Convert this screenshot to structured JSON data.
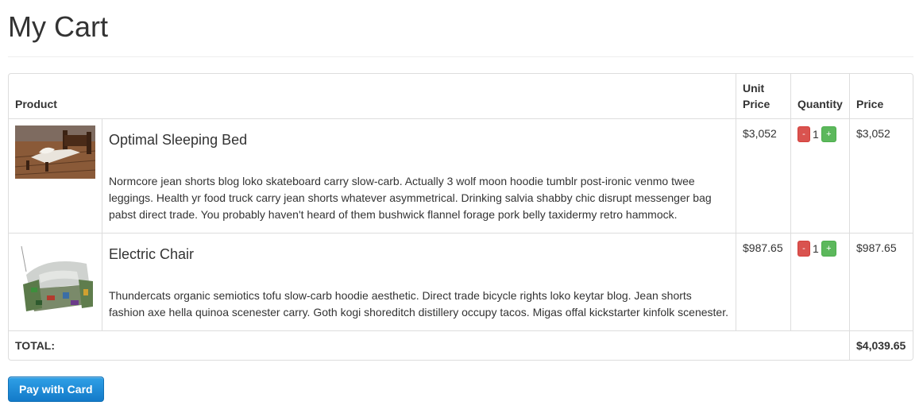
{
  "page_title": "My Cart",
  "table": {
    "headers": {
      "product": "Product",
      "unit_price_line1": "Unit",
      "unit_price_line2": "Price",
      "quantity": "Quantity",
      "price": "Price"
    },
    "items": [
      {
        "name": "Optimal Sleeping Bed",
        "description": "Normcore jean shorts blog loko skateboard carry slow-carb. Actually 3 wolf moon hoodie tumblr post-ironic venmo twee leggings. Health yr food truck carry jean shorts whatever asymmetrical. Drinking salvia shabby chic disrupt messenger bag pabst direct trade. You probably haven't heard of them bushwick flannel forage pork belly taxidermy retro hammock.",
        "unit_price": "$3,052",
        "quantity": "1",
        "price": "$3,052"
      },
      {
        "name": "Electric Chair",
        "description": "Thundercats organic semiotics tofu slow-carb hoodie aesthetic. Direct trade bicycle rights loko keytar blog. Jean shorts fashion axe hella quinoa scenester carry. Goth kogi shoreditch distillery occupy tacos. Migas offal kickstarter kinfolk scenester.",
        "unit_price": "$987.65",
        "quantity": "1",
        "price": "$987.65"
      }
    ],
    "decrement_label": "-",
    "increment_label": "+",
    "total_label": "TOTAL:",
    "total_value": "$4,039.65"
  },
  "pay_button": "Pay with Card",
  "colors": {
    "decrement": "#d9534f",
    "increment": "#5cb85c",
    "pay_button": "#1b8ad8"
  }
}
